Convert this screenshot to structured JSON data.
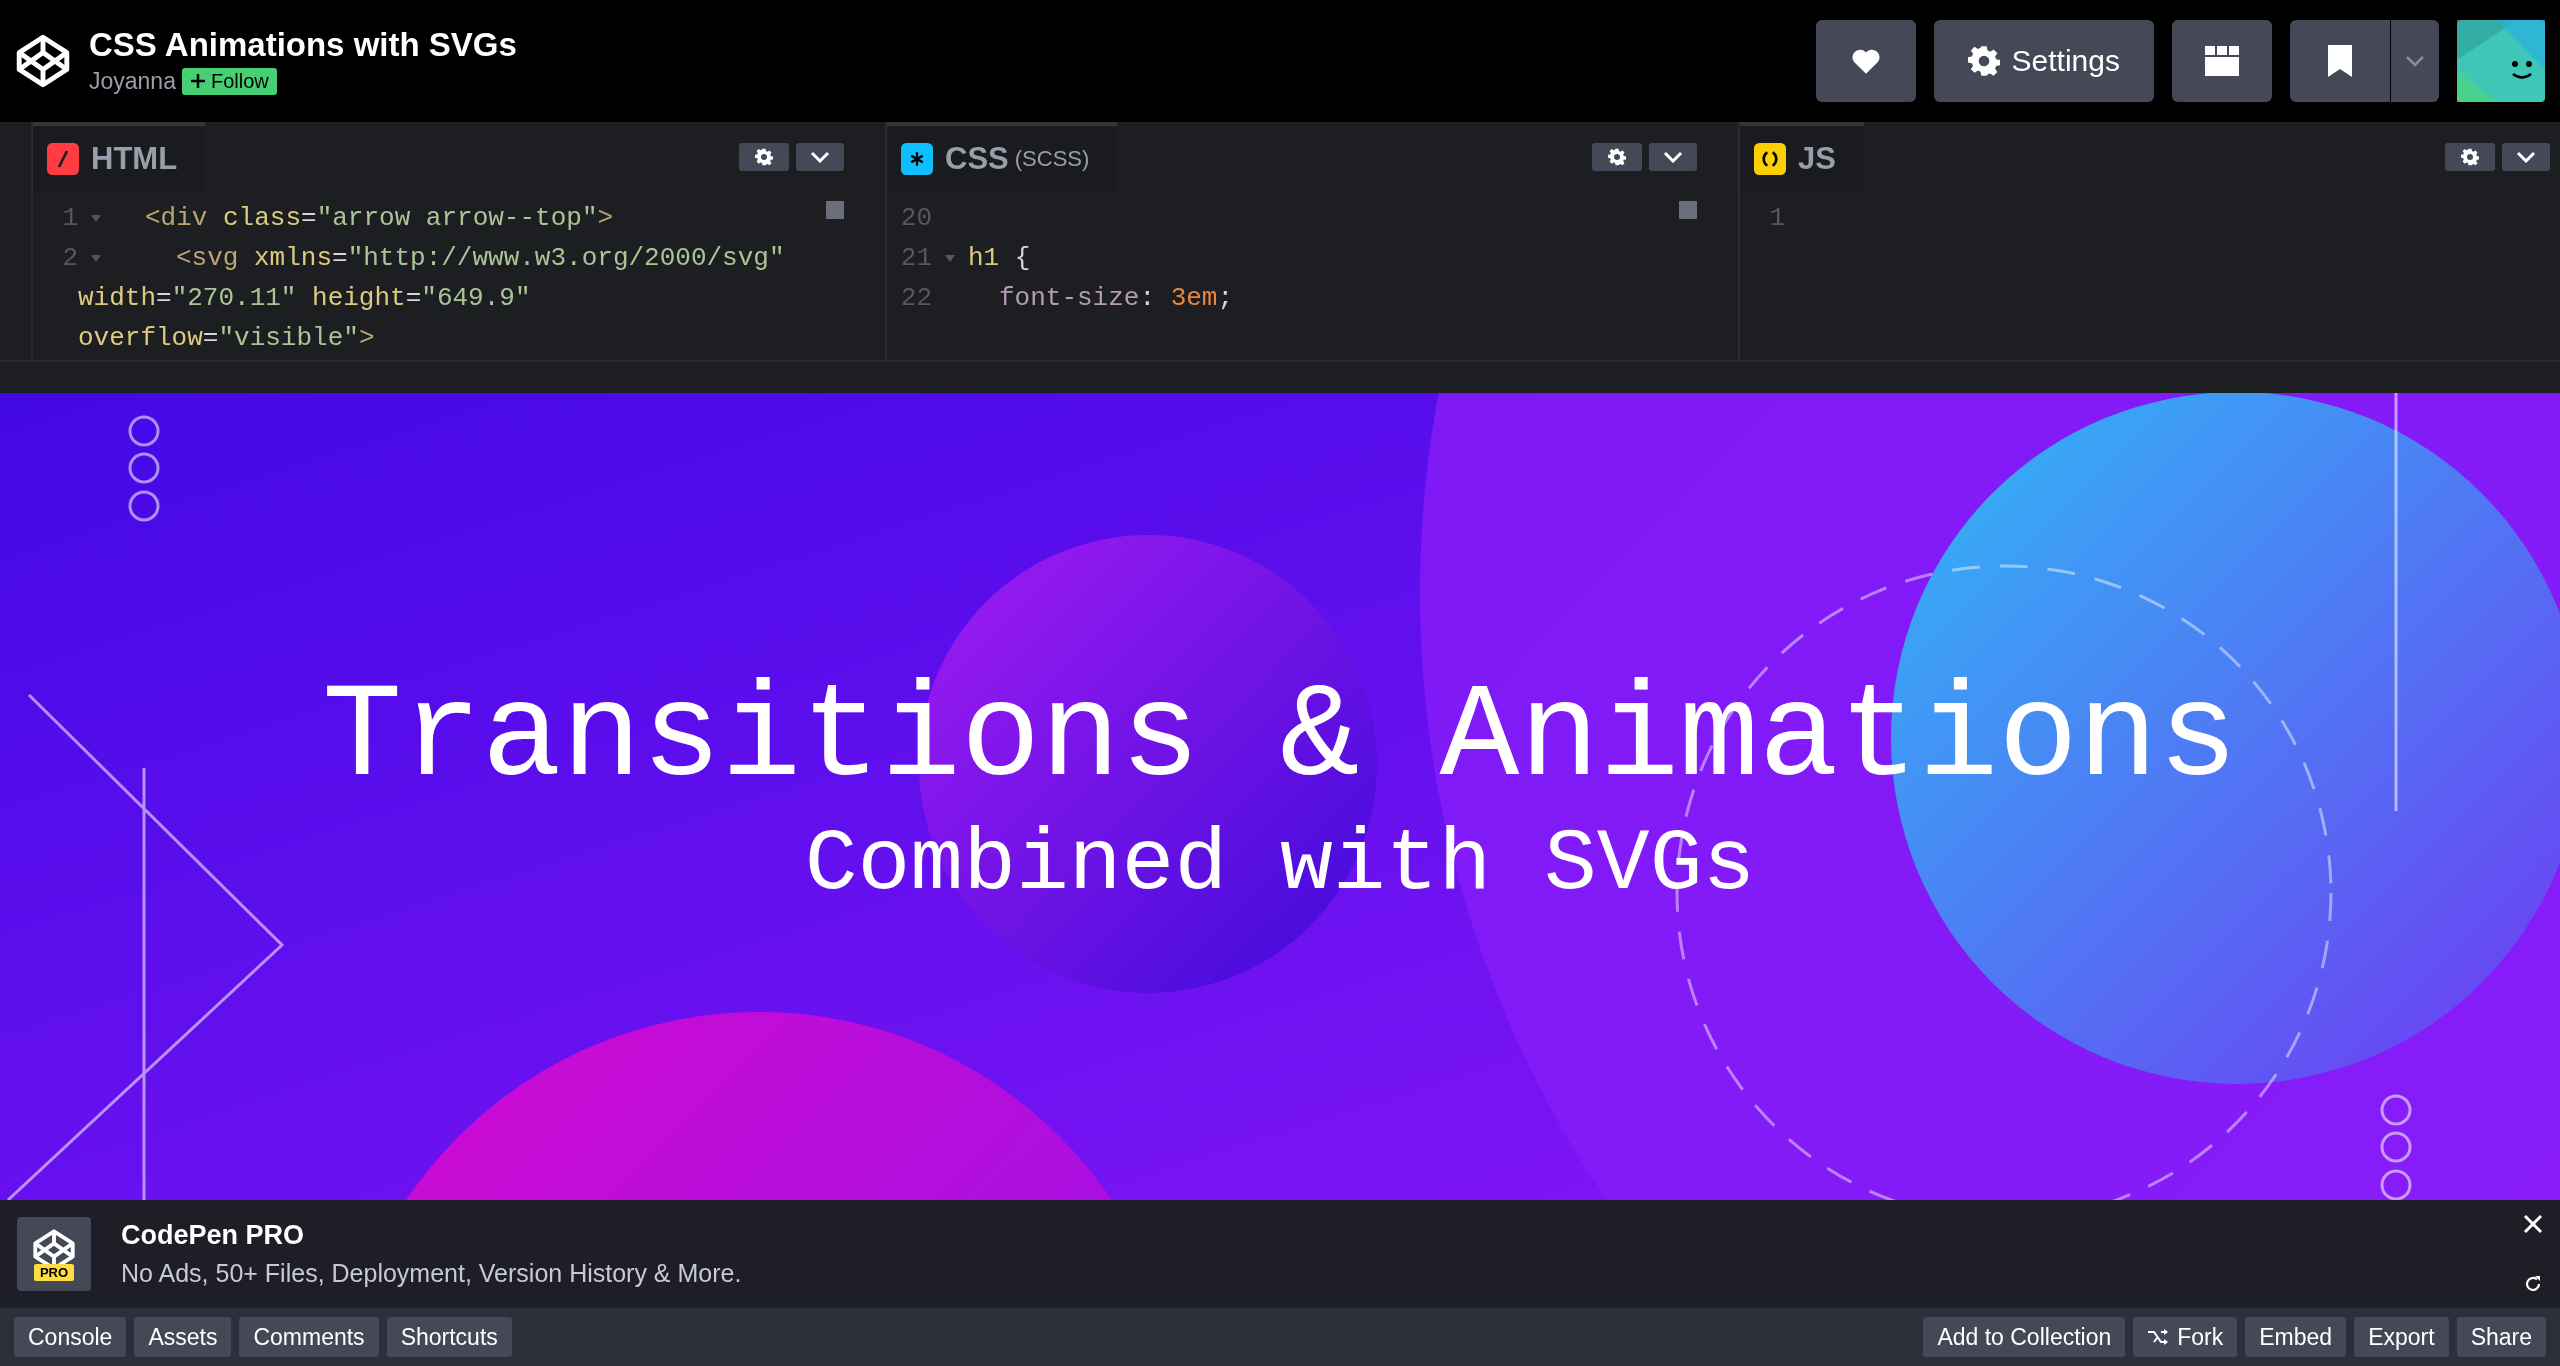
{
  "header": {
    "title": "CSS Animations with SVGs",
    "author": "Joyanna",
    "follow": "Follow",
    "buttons": [
      {
        "kind": "heart"
      },
      {
        "kind": "settings",
        "label": "Settings"
      },
      {
        "kind": "layout"
      },
      {
        "kind": "bookmark"
      },
      {
        "kind": "caret"
      }
    ]
  },
  "editors": [
    {
      "kind": "html",
      "label": "HTML",
      "color": "#ff3c41",
      "lines": [
        {
          "number": "1",
          "kind": "inner",
          "foldable": true,
          "tokens": [
            {
              "kind": "tag",
              "s": "<div "
            },
            {
              "kind": "attr",
              "s": "class"
            },
            {
              "kind": "plain",
              "s": "="
            },
            {
              "kind": "string",
              "s": "\"arrow arrow--top\""
            },
            {
              "kind": "tag",
              "s": ">"
            }
          ]
        },
        {
          "number": "2",
          "kind": "deep",
          "foldable": true,
          "tokens": [
            {
              "kind": "tag",
              "s": "<svg "
            },
            {
              "kind": "attr",
              "s": "xmlns"
            },
            {
              "kind": "plain",
              "s": "="
            },
            {
              "kind": "string",
              "s": "\"http://www.w3.org/2000/svg\""
            }
          ]
        },
        {
          "kind": "wrap",
          "tokens": [
            {
              "kind": "attr",
              "s": "width"
            },
            {
              "kind": "plain",
              "s": "="
            },
            {
              "kind": "string",
              "s": "\"270.11\" "
            },
            {
              "kind": "attr",
              "s": "height"
            },
            {
              "kind": "plain",
              "s": "="
            },
            {
              "kind": "string",
              "s": "\"649.9\""
            }
          ]
        },
        {
          "kind": "wrap",
          "tokens": [
            {
              "kind": "attr",
              "s": "overflow"
            },
            {
              "kind": "plain",
              "s": "="
            },
            {
              "kind": "string",
              "s": "\"visible\""
            },
            {
              "kind": "tag",
              "s": ">"
            }
          ]
        }
      ]
    },
    {
      "kind": "css",
      "label": "CSS",
      "sublabel": "(SCSS)",
      "color": "#0ebeff",
      "lines": [
        {
          "number": "20",
          "foldable": false
        },
        {
          "number": "21",
          "kind": "top",
          "foldable": true,
          "tokens": [
            {
              "kind": "selector",
              "s": "h1"
            },
            {
              "kind": "plain",
              "s": " {"
            }
          ]
        },
        {
          "number": "22",
          "kind": "inner",
          "foldable": false,
          "tokens": [
            {
              "kind": "property",
              "s": "font-size"
            },
            {
              "kind": "plain",
              "s": ": "
            },
            {
              "kind": "number",
              "s": "3em"
            },
            {
              "kind": "plain",
              "s": ";"
            }
          ]
        }
      ]
    },
    {
      "kind": "js",
      "label": "JS",
      "color": "#fcd000",
      "lines": [
        {
          "number": "1",
          "foldable": false
        }
      ]
    }
  ],
  "preview": {
    "title": "Transitions & Animations",
    "subtitle": "Combined with SVGs"
  },
  "promo": {
    "badge": "PRO",
    "title": "CodePen PRO",
    "description": "No Ads, 50+ Files, Deployment, Version History & More."
  },
  "footer": {
    "left": [
      {
        "kind": "plain",
        "label": "Console"
      },
      {
        "kind": "plain",
        "label": "Assets"
      },
      {
        "kind": "plain",
        "label": "Comments"
      },
      {
        "kind": "plain",
        "label": "Shortcuts"
      }
    ],
    "right": [
      {
        "kind": "plain",
        "label": "Add to Collection"
      },
      {
        "kind": "fork",
        "label": "Fork"
      },
      {
        "kind": "plain",
        "label": "Embed"
      },
      {
        "kind": "plain",
        "label": "Export"
      },
      {
        "kind": "plain",
        "label": "Share"
      }
    ]
  }
}
